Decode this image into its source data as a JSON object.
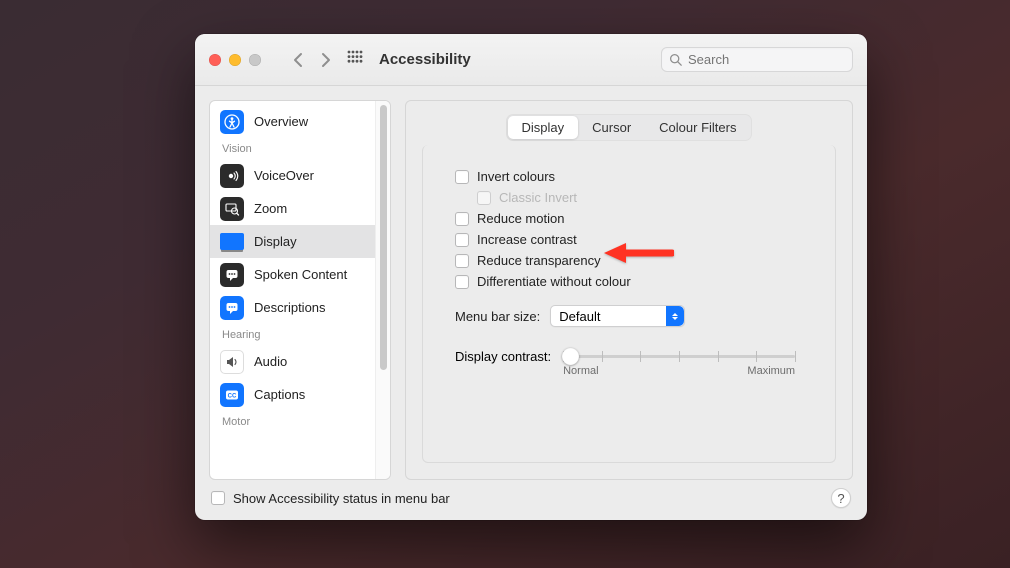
{
  "window": {
    "title": "Accessibility"
  },
  "search": {
    "placeholder": "Search"
  },
  "sidebar": {
    "groups": {
      "vision": "Vision",
      "hearing": "Hearing",
      "motor": "Motor"
    },
    "items": [
      {
        "label": "Overview"
      },
      {
        "label": "VoiceOver"
      },
      {
        "label": "Zoom"
      },
      {
        "label": "Display"
      },
      {
        "label": "Spoken Content"
      },
      {
        "label": "Descriptions"
      },
      {
        "label": "Audio"
      },
      {
        "label": "Captions"
      }
    ]
  },
  "tabs": {
    "display": "Display",
    "cursor": "Cursor",
    "colour_filters": "Colour Filters"
  },
  "checkboxes": {
    "invert_colours": "Invert colours",
    "classic_invert": "Classic Invert",
    "reduce_motion": "Reduce motion",
    "increase_contrast": "Increase contrast",
    "reduce_transparency": "Reduce transparency",
    "differentiate_without_colour": "Differentiate without colour"
  },
  "menu_bar_size": {
    "label": "Menu bar size:",
    "value": "Default"
  },
  "display_contrast": {
    "label": "Display contrast:",
    "min_label": "Normal",
    "max_label": "Maximum"
  },
  "footer": {
    "show_status_label": "Show Accessibility status in menu bar",
    "help": "?"
  }
}
